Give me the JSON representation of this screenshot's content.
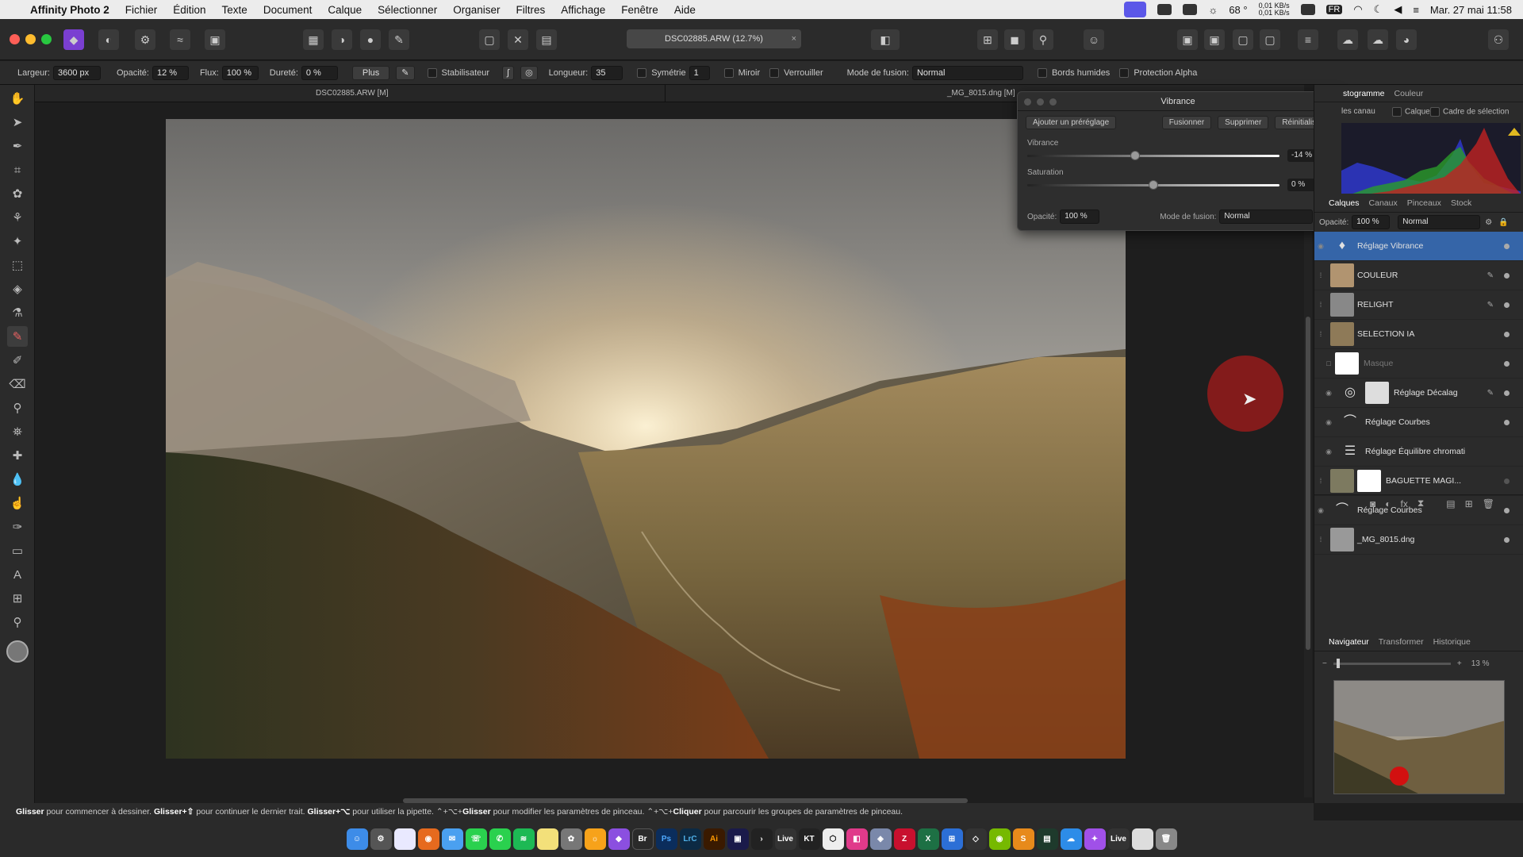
{
  "menubar": {
    "app": "Affinity Photo 2",
    "items": [
      "Fichier",
      "Édition",
      "Texte",
      "Document",
      "Calque",
      "Sélectionner",
      "Organiser",
      "Filtres",
      "Affichage",
      "Fenêtre",
      "Aide"
    ],
    "temp": "68 °",
    "net_up": "0,01 KB/s",
    "net_down": "0,01 KB/s",
    "lang": "FR",
    "datetime": "Mar. 27 mai  11:58"
  },
  "toolbar": {
    "doc_title": "DSC02885.ARW (12.7%)",
    "close": "×"
  },
  "context": {
    "width_label": "Largeur:",
    "width_value": "3600 px",
    "opacity_label": "Opacité:",
    "opacity_value": "12 %",
    "flux_label": "Flux:",
    "flux_value": "100 %",
    "hardness_label": "Dureté:",
    "hardness_value": "0 %",
    "plus": "Plus",
    "stabilizer": "Stabilisateur",
    "length_label": "Longueur:",
    "length_value": "35",
    "symmetry": "Symétrie",
    "symmetry_value": "1",
    "mirror": "Miroir",
    "lock": "Verrouiller",
    "blend_label": "Mode de fusion:",
    "blend_value": "Normal",
    "wet_edges": "Bords humides",
    "alpha": "Protection Alpha"
  },
  "tabs": {
    "doc1": "DSC02885.ARW [M]",
    "doc2": "_MG_8015.dng [M]"
  },
  "vibrance": {
    "title": "Vibrance",
    "add_preset": "Ajouter un préréglage",
    "merge": "Fusionner",
    "delete": "Supprimer",
    "reset": "Réinitialiser",
    "vib_label": "Vibrance",
    "vib_value": "-14 %",
    "vib_level": -14,
    "sat_label": "Saturation",
    "sat_value": "0 %",
    "sat_level": 0,
    "opacity_label": "Opacité:",
    "opacity_value": "100 %",
    "blend_label": "Mode de fusion:",
    "blend_value": "Normal"
  },
  "histogram": {
    "tab1": "stogramme",
    "tab2": "Couleur",
    "opt1": "les canau",
    "opt2": "Calque",
    "opt3": "Cadre de sélection"
  },
  "layers_panel": {
    "tabs": [
      "Calques",
      "Canaux",
      "Pinceaux",
      "Stock"
    ],
    "opacity_label": "Opacité:",
    "opacity_value": "100 %",
    "blend_value": "Normal",
    "items": [
      {
        "name": "Réglage Vibrance"
      },
      {
        "name": "COULEUR"
      },
      {
        "name": "RELIGHT"
      },
      {
        "name": "SELECTION IA"
      },
      {
        "name": "Masque"
      },
      {
        "name": "Réglage Décalag"
      },
      {
        "name": "Réglage Courbes"
      },
      {
        "name": "Réglage Équilibre chromati"
      },
      {
        "name": "BAGUETTE MAGI..."
      },
      {
        "name": "Réglage Courbes"
      },
      {
        "name": "_MG_8015.dng"
      }
    ]
  },
  "navigator": {
    "tabs": [
      "Navigateur",
      "Transformer",
      "Historique"
    ],
    "zoom": "13 %"
  },
  "status": {
    "b1": "Glisser",
    "t1": " pour commencer à dessiner. ",
    "b2": "Glisser+⇧",
    "t2": " pour continuer le dernier trait. ",
    "b3": "Glisser+⌥",
    "t3": " pour utiliser la pipette. ⌃+⌥+",
    "b4": "Glisser",
    "t4": " pour modifier les paramètres de pinceau. ⌃+⌥+",
    "b5": "Cliquer",
    "t5": " pour parcourir les groupes de paramètres de pinceau."
  },
  "dock": [
    "Br",
    "Ps",
    "LrC",
    "Ai",
    "Live",
    "Live"
  ]
}
